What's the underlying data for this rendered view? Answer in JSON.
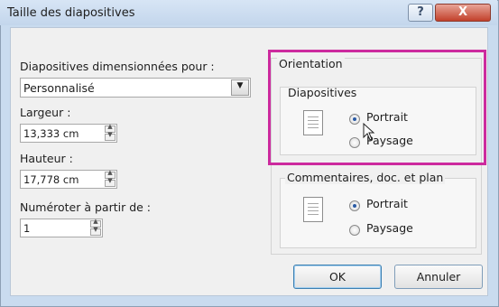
{
  "dialog": {
    "title": "Taille des diapositives",
    "help_glyph": "?",
    "close_glyph": "X"
  },
  "left": {
    "size_for_label": "Diapositives dimensionnées pour :",
    "size_for_value": "Personnalisé",
    "width_label": "Largeur :",
    "width_value": "13,333  cm",
    "height_label": "Hauteur :",
    "height_value": "17,778  cm",
    "number_from_label": "Numéroter à partir de :",
    "number_from_value": "1"
  },
  "orientation": {
    "group_label": "Orientation",
    "slides": {
      "label": "Diapositives",
      "portrait": "Portrait",
      "landscape": "Paysage",
      "selected": "portrait"
    },
    "notes": {
      "label": "Commentaires, doc. et plan",
      "portrait": "Portrait",
      "landscape": "Paysage",
      "selected": "portrait"
    }
  },
  "buttons": {
    "ok": "OK",
    "cancel": "Annuler"
  },
  "colors": {
    "highlight": "#cc2a9e",
    "title_bar": "#c9dbef",
    "close_button": "#c2402b"
  },
  "icons": [
    "help-icon",
    "close-icon",
    "dropdown-arrow-icon",
    "spin-up-icon",
    "spin-down-icon",
    "document-page-icon",
    "mouse-pointer-icon"
  ]
}
